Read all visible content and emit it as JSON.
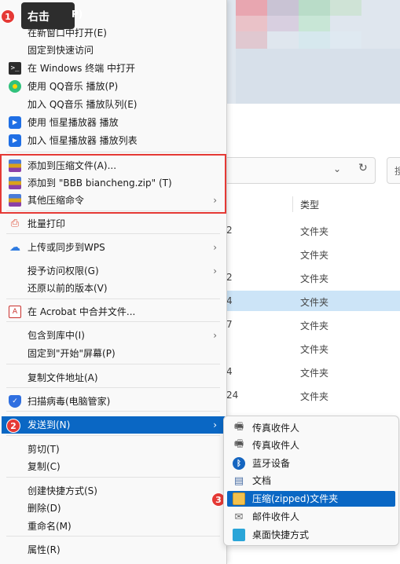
{
  "tooltip": {
    "label": "右击",
    "tail": "P)"
  },
  "badges": [
    "1",
    "2",
    "3"
  ],
  "menu": {
    "items": [
      {
        "label": "在新窗口中打开(E)",
        "icon": "none"
      },
      {
        "label": "固定到快速访问",
        "icon": "none"
      },
      {
        "label": "在 Windows 终端 中打开",
        "icon": "terminal-icon",
        "glyph": ">_"
      },
      {
        "label": "使用 QQ音乐 播放(P)",
        "icon": "qq-music-icon",
        "glyph": ""
      },
      {
        "label": "加入 QQ音乐 播放队列(E)",
        "icon": "none"
      },
      {
        "label": "使用 恒星播放器 播放",
        "icon": "player-icon",
        "glyph": "▶"
      },
      {
        "label": "加入 恒星播放器 播放列表",
        "icon": "player-icon",
        "glyph": "▶"
      },
      {
        "label": "添加到压缩文件(A)...",
        "icon": "winrar-icon",
        "glyph": ""
      },
      {
        "label": "添加到 \"BBB biancheng.zip\" (T)",
        "icon": "winrar-icon",
        "glyph": ""
      },
      {
        "label": "其他压缩命令",
        "icon": "winrar-icon",
        "glyph": "",
        "arrow": "›"
      },
      {
        "label": "批量打印",
        "icon": "print-icon",
        "glyph": "⎙"
      },
      {
        "label": "上传或同步到WPS",
        "icon": "cloud-upload-icon",
        "glyph": "☁",
        "arrow": "›"
      },
      {
        "label": "授予访问权限(G)",
        "icon": "none",
        "arrow": "›"
      },
      {
        "label": "还原以前的版本(V)",
        "icon": "none"
      },
      {
        "label": "在 Acrobat 中合并文件...",
        "icon": "acrobat-icon",
        "glyph": "A"
      },
      {
        "label": "包含到库中(I)",
        "icon": "none",
        "arrow": "›"
      },
      {
        "label": "固定到\"开始\"屏幕(P)",
        "icon": "none"
      },
      {
        "label": "复制文件地址(A)",
        "icon": "none"
      },
      {
        "label": "扫描病毒(电脑管家)",
        "icon": "shield-icon",
        "glyph": "✓"
      },
      {
        "label": "发送到(N)",
        "icon": "none",
        "arrow": "›",
        "highlight": true
      },
      {
        "label": "剪切(T)",
        "icon": "none"
      },
      {
        "label": "复制(C)",
        "icon": "none"
      },
      {
        "label": "创建快捷方式(S)",
        "icon": "none"
      },
      {
        "label": "删除(D)",
        "icon": "none"
      },
      {
        "label": "重命名(M)",
        "icon": "none"
      },
      {
        "label": "属性(R)",
        "icon": "none"
      }
    ]
  },
  "submenu": {
    "items": [
      {
        "label": "传真收件人",
        "icon": "fax-icon",
        "glyph": "🖷"
      },
      {
        "label": "传真收件人",
        "icon": "fax-icon",
        "glyph": "🖷"
      },
      {
        "label": "蓝牙设备",
        "icon": "bluetooth-icon",
        "glyph": "ᛒ"
      },
      {
        "label": "文档",
        "icon": "document-icon",
        "glyph": "▤"
      },
      {
        "label": "压缩(zipped)文件夹",
        "icon": "zip-folder-icon",
        "glyph": "",
        "highlight": true
      },
      {
        "label": "邮件收件人",
        "icon": "mail-icon",
        "glyph": "✉"
      },
      {
        "label": "桌面快捷方式",
        "icon": "desktop-shortcut-icon",
        "glyph": ""
      }
    ]
  },
  "explorer": {
    "address_dropdown": "⌄",
    "refresh": "↻",
    "search_char": "搜",
    "type_header": "类型",
    "rows": [
      {
        "date": "2",
        "type": "文件夹"
      },
      {
        "date": "",
        "type": "文件夹"
      },
      {
        "date": "2",
        "type": "文件夹"
      },
      {
        "date": "4",
        "type": "文件夹",
        "selected": true
      },
      {
        "date": "7",
        "type": "文件夹"
      },
      {
        "date": "",
        "type": "文件夹"
      },
      {
        "date": "4",
        "type": "文件夹"
      },
      {
        "date": "24",
        "type": "文件夹"
      }
    ]
  }
}
